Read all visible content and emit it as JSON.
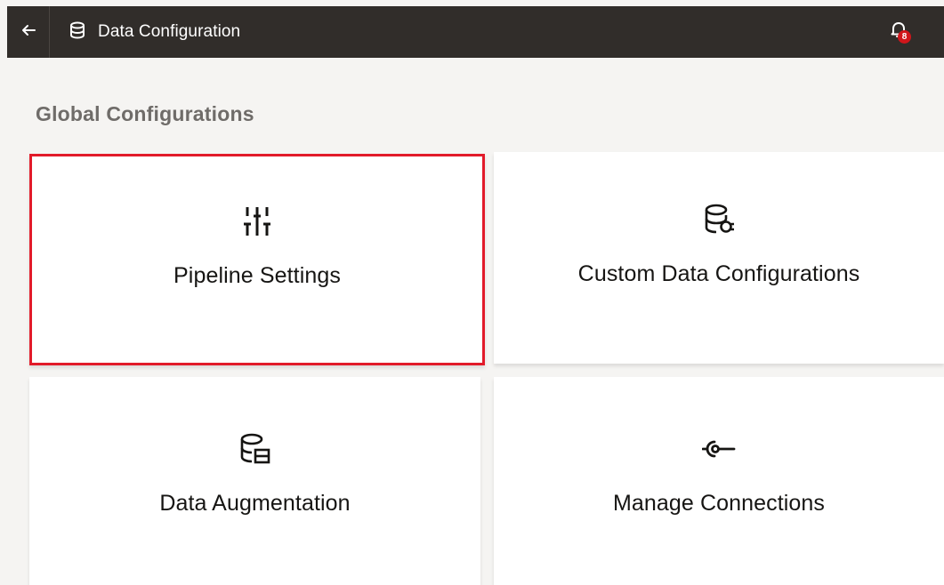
{
  "header": {
    "title": "Data Configuration",
    "back_icon": "arrow-left-icon",
    "app_icon": "database-icon",
    "notifications_icon": "bell-icon",
    "notification_count": "8",
    "background": "#312d2a",
    "badge_color": "#d0161b"
  },
  "main": {
    "section_title": "Global Configurations",
    "cards": [
      {
        "label": "Pipeline Settings",
        "icon": "sliders-icon",
        "selected": true
      },
      {
        "label": "Custom Data Configurations",
        "icon": "database-plug-icon",
        "selected": false
      },
      {
        "label": "Data Augmentation",
        "icon": "database-table-icon",
        "selected": false
      },
      {
        "label": "Manage Connections",
        "icon": "connection-icon",
        "selected": false
      }
    ],
    "selection_color": "#e21b2a"
  }
}
